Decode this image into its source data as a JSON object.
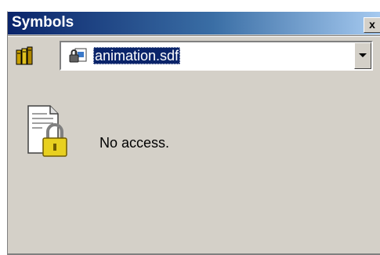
{
  "window": {
    "title": "Symbols",
    "close_label": "x"
  },
  "toolbar": {
    "library_icon": "books-icon",
    "file_icon": "locked-file-icon",
    "selected_file": "animation.sdf"
  },
  "content": {
    "status_icon": "locked-document-icon",
    "message": "No access."
  },
  "colors": {
    "titlebar_start": "#0a246a",
    "titlebar_end": "#a6caf0",
    "panel_bg": "#d4d0c8",
    "selection_bg": "#0a246a"
  }
}
